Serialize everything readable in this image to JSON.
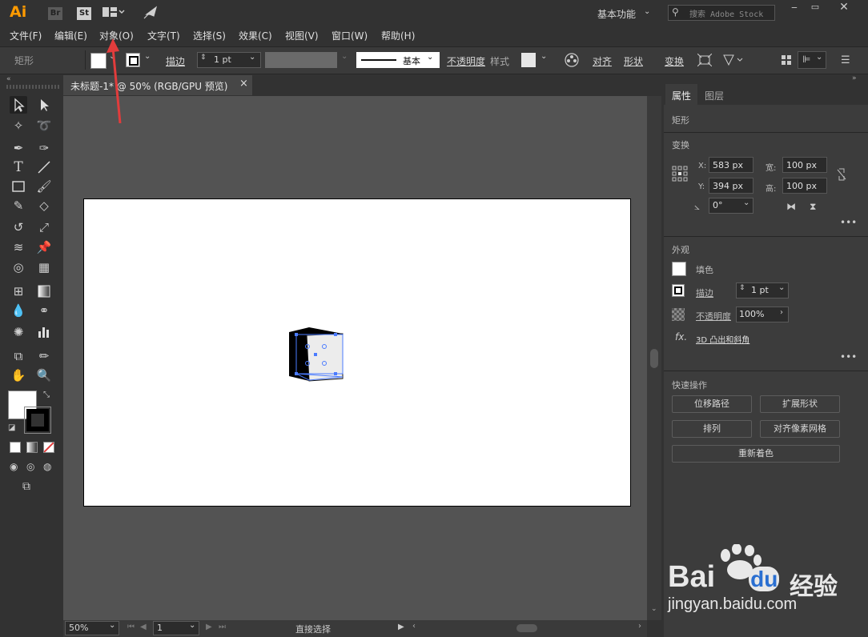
{
  "app": {
    "logo": "Ai",
    "bridge": "Br",
    "stock": "St",
    "workspace": "基本功能",
    "search_placeholder": "搜索 Adobe Stock"
  },
  "menu": [
    "文件(F)",
    "编辑(E)",
    "对象(O)",
    "文字(T)",
    "选择(S)",
    "效果(C)",
    "视图(V)",
    "窗口(W)",
    "帮助(H)"
  ],
  "control": {
    "object_type": "矩形",
    "stroke_label": "描边",
    "stroke_value": "1 pt",
    "brush_label": "基本",
    "opacity_label": "不透明度",
    "style_label": "样式",
    "align_label": "对齐",
    "shape_label": "形状",
    "transform_label": "变换"
  },
  "document": {
    "tab_title": "未标题-1* @ 50% (RGB/GPU 预览)",
    "close": "×"
  },
  "status": {
    "zoom": "50%",
    "artboard": "1",
    "tool": "直接选择"
  },
  "panel": {
    "tab_properties": "属性",
    "tab_layers": "图层",
    "object_type": "矩形",
    "transform_title": "变换",
    "x_label": "X:",
    "x_value": "583 px",
    "y_label": "Y:",
    "y_value": "394 px",
    "w_label": "宽:",
    "w_value": "100 px",
    "h_label": "高:",
    "h_value": "100 px",
    "angle_value": "0°",
    "appearance_title": "外观",
    "fill_label": "填色",
    "stroke_label": "描边",
    "stroke_value": "1 pt",
    "opacity_label": "不透明度",
    "opacity_value": "100%",
    "fx_label": "fx.",
    "effect_label": "3D 凸出和斜角",
    "quick_title": "快速操作",
    "btn_offset": "位移路径",
    "btn_expand": "扩展形状",
    "btn_arrange": "排列",
    "btn_pixel": "对齐像素网格",
    "btn_recolor": "重新着色"
  },
  "watermark": {
    "brand": "Bai",
    "brand2": "du",
    "cn": "经验",
    "url": "jingyan.baidu.com"
  },
  "colors": {
    "accent_arrow": "#e23c3c",
    "selection": "#4a7bff",
    "logo": "#ff9a00"
  }
}
